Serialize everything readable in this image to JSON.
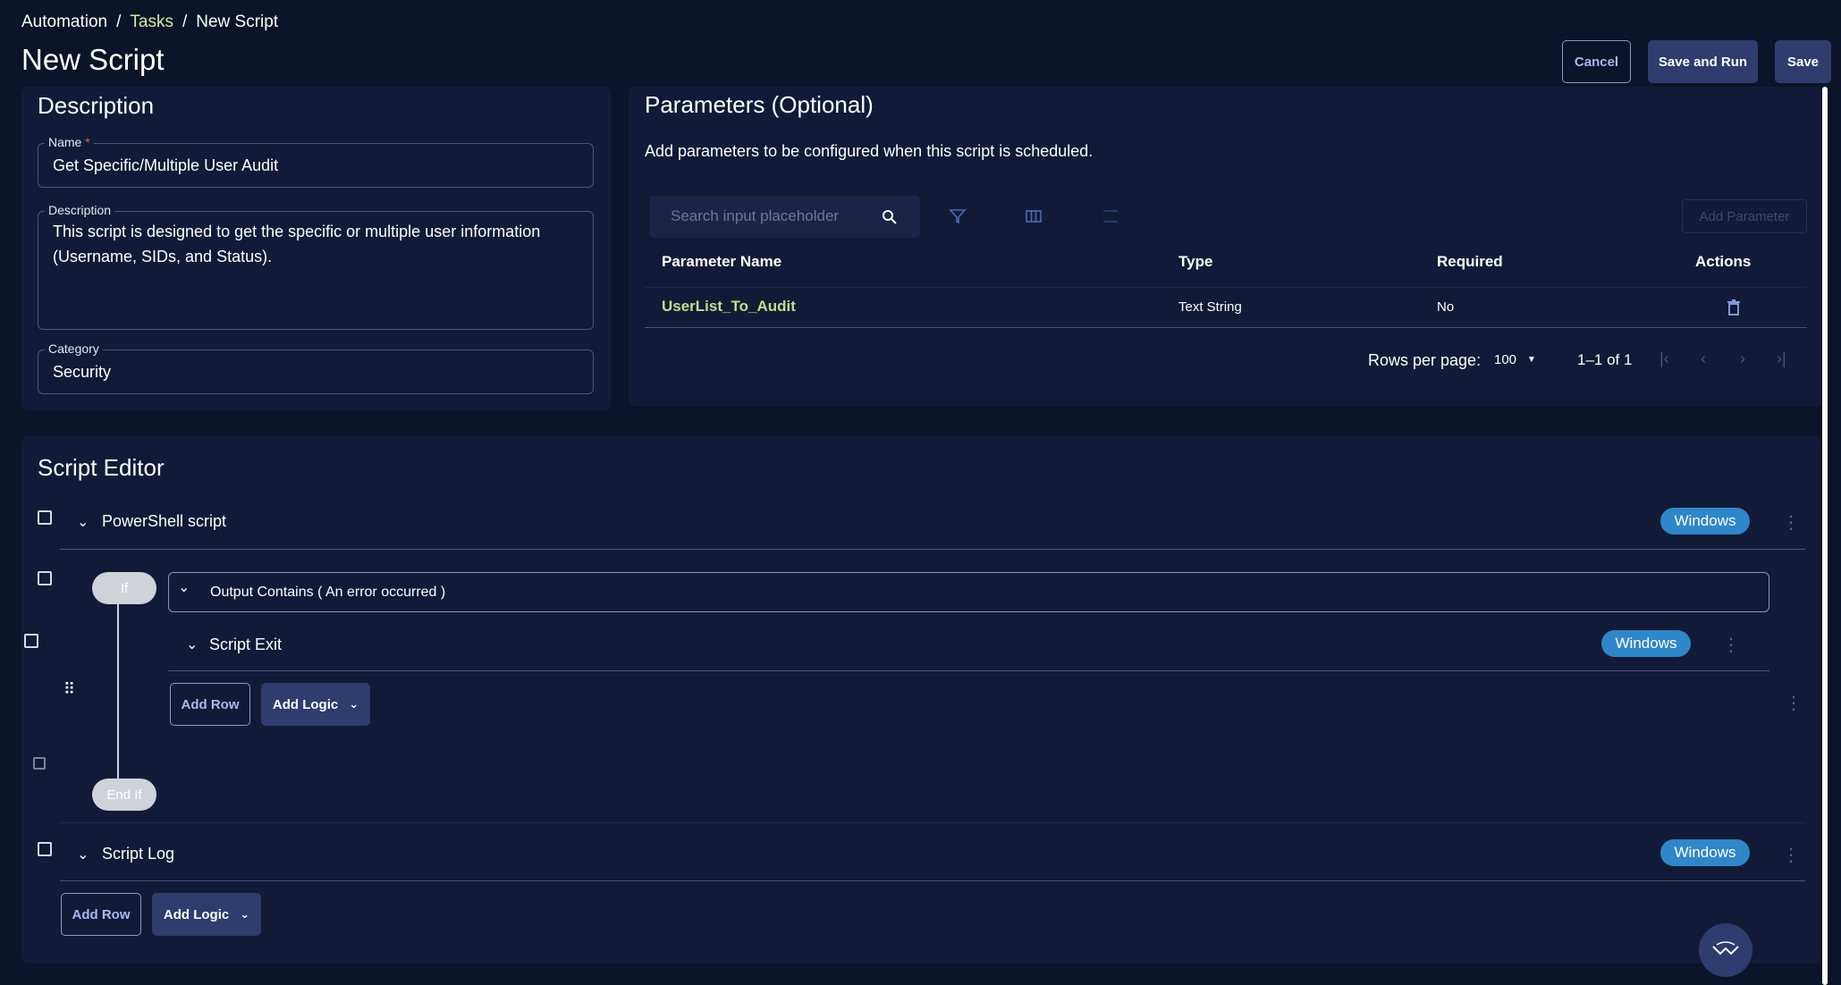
{
  "breadcrumb": {
    "root": "Automation",
    "middle": "Tasks",
    "current": "New Script",
    "separator": "/"
  },
  "page_title": "New Script",
  "actions": {
    "cancel": "Cancel",
    "save_and_run": "Save and Run",
    "save": "Save"
  },
  "description_panel": {
    "title": "Description",
    "name_label": "Name",
    "required_mark": "*",
    "name_value": "Get Specific/Multiple User Audit",
    "description_label": "Description",
    "description_value": "This script is designed to get the specific or multiple user information (Username, SIDs, and Status).",
    "category_label": "Category",
    "category_value": "Security"
  },
  "parameters_panel": {
    "title": "Parameters (Optional)",
    "subtitle": "Add parameters to be configured when this script is scheduled.",
    "search_placeholder": "Search input placeholder",
    "add_parameter": "Add Parameter",
    "columns": [
      "Parameter Name",
      "Type",
      "Required",
      "Actions"
    ],
    "rows": [
      {
        "name": "UserList_To_Audit",
        "type": "Text String",
        "required": "No"
      }
    ],
    "rows_per_page_label": "Rows per page:",
    "rows_per_page_value": "100",
    "range": "1–1 of 1"
  },
  "script_editor": {
    "title": "Script Editor",
    "rows": {
      "powershell": {
        "label": "PowerShell script",
        "os": "Windows"
      },
      "if_block": {
        "if_label": "If",
        "condition": "Output Contains ( An error occurred )",
        "inner_row": {
          "label": "Script Exit",
          "os": "Windows"
        },
        "add_row": "Add Row",
        "add_logic": "Add Logic",
        "end_label": "End If"
      },
      "script_log": {
        "label": "Script Log",
        "os": "Windows"
      }
    },
    "add_row": "Add Row",
    "add_logic": "Add Logic"
  },
  "icons": {
    "search": "search-icon",
    "filter": "filter-icon",
    "columns": "columns-icon",
    "density": "density-icon",
    "delete": "trash-icon",
    "first": "first-page-icon",
    "prev": "prev-page-icon",
    "next": "next-page-icon",
    "last": "last-page-icon",
    "chevron": "chevron-down-icon",
    "kebab": "more-vert-icon",
    "drag": "drag-handle-icon",
    "assistant": "assistant-icon"
  },
  "colors": {
    "background": "#0b1428",
    "panel": "#111b37",
    "accent_link": "#c8dc8c",
    "badge": "#2f86c8",
    "button_fill": "#2e3c6e"
  }
}
